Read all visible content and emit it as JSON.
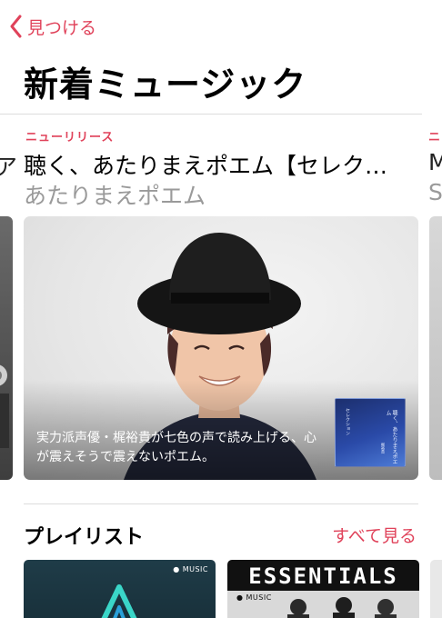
{
  "nav": {
    "back_label": "見つける"
  },
  "page": {
    "title": "新着ミュージック"
  },
  "featured": {
    "label": "ニューリリース",
    "title": "聴く、あたりまえポエム【セレク…",
    "subtitle": "あたりまえポエム",
    "description": "実力派声優・梶裕貴が七色の声で読み上げる、心が震えそうで震えないポエム。",
    "album_art_text": [
      "聴く、あたりまえポエム",
      "セレクション",
      "梶裕貴"
    ]
  },
  "peek": {
    "left_title": "ア",
    "right_label": "ニ",
    "right_title": "M",
    "right_subtitle": "S"
  },
  "playlists": {
    "section_title": "プレイリスト",
    "see_all": "すべて見る",
    "items": [
      {
        "badge": "MUSIC"
      },
      {
        "title": "ESSENTIALS",
        "badge": "MUSIC"
      }
    ]
  },
  "colors": {
    "accent": "#e0425a",
    "subtitle_gray": "#9a9a9a",
    "divider": "#dcdcdc"
  }
}
